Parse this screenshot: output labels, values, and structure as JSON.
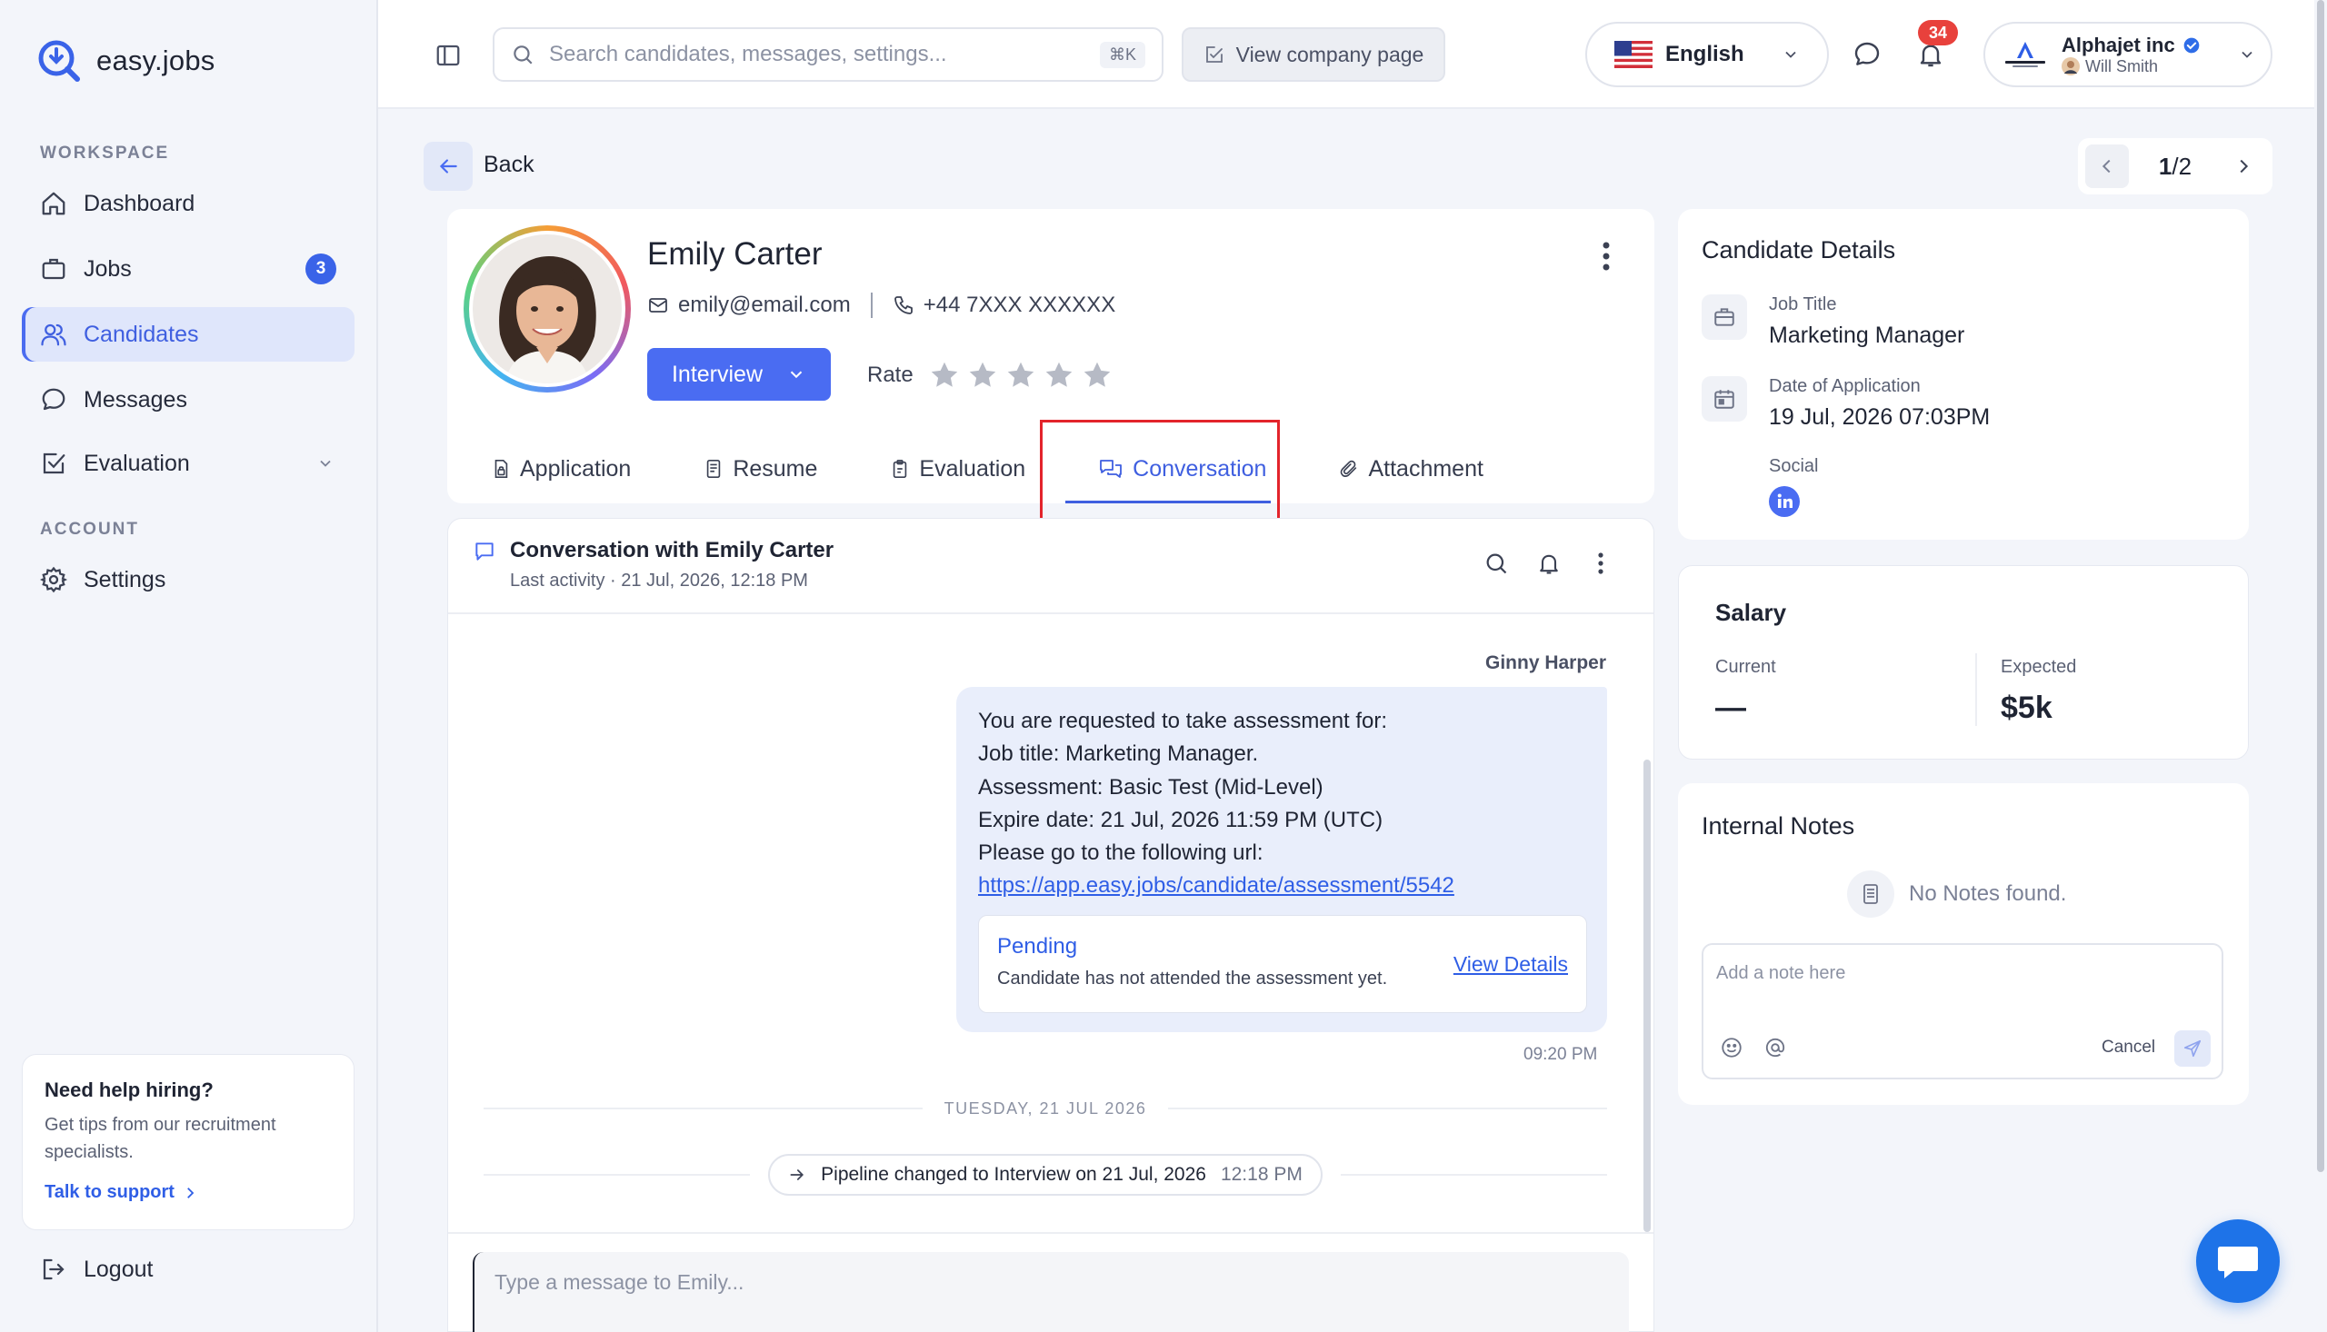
{
  "brand": {
    "name": "easy.jobs"
  },
  "sidebar": {
    "workspace_label": "WORKSPACE",
    "account_label": "ACCOUNT",
    "items": [
      {
        "label": "Dashboard"
      },
      {
        "label": "Jobs",
        "badge": "3"
      },
      {
        "label": "Candidates"
      },
      {
        "label": "Messages"
      },
      {
        "label": "Evaluation"
      },
      {
        "label": "Settings"
      }
    ],
    "help": {
      "title": "Need help hiring?",
      "text": "Get tips from our recruitment specialists.",
      "link": "Talk to support"
    },
    "logout": "Logout"
  },
  "topbar": {
    "search_placeholder": "Search candidates, messages, settings...",
    "search_shortcut": "⌘K",
    "company_button": "View company page",
    "language": "English",
    "notification_count": "34",
    "account_company": "Alphajet inc",
    "account_user": "Will Smith"
  },
  "nav": {
    "back": "Back",
    "pager_current": "1",
    "pager_total": "/2"
  },
  "candidate": {
    "name": "Emily Carter",
    "email": "emily@email.com",
    "phone": "+44 7XXX XXXXXX",
    "stage": "Interview",
    "rate_label": "Rate",
    "rating": 0
  },
  "tabs": [
    {
      "label": "Application"
    },
    {
      "label": "Resume"
    },
    {
      "label": "Evaluation"
    },
    {
      "label": "Conversation",
      "active": true
    },
    {
      "label": "Attachment"
    }
  ],
  "conversation": {
    "title": "Conversation with Emily Carter",
    "subtitle": "Last activity · 21 Jul, 2026, 12:18 PM",
    "sender": "Ginny Harper",
    "message_lines": [
      "You are requested to take assessment for:",
      "Job title: Marketing Manager.",
      "Assessment: Basic Test (Mid-Level)",
      "Expire date: 21 Jul, 2026 11:59 PM (UTC)",
      "Please go to the following url:"
    ],
    "message_link": "https://app.easy.jobs/candidate/assessment/5542",
    "assessment_status": "Pending",
    "assessment_desc": "Candidate has not attended the assessment yet.",
    "assessment_link": "View Details",
    "message_time": "09:20 PM",
    "date_divider": "TUESDAY, 21 JUL 2026",
    "pipeline_event": "Pipeline changed to Interview on 21 Jul, 2026",
    "pipeline_time": "12:18 PM",
    "composer_placeholder": "Type a message to Emily..."
  },
  "details": {
    "title": "Candidate Details",
    "job_title_label": "Job Title",
    "job_title": "Marketing Manager",
    "date_label": "Date of Application",
    "date": "19 Jul, 2026 07:03PM",
    "social_label": "Social"
  },
  "salary": {
    "title": "Salary",
    "current_label": "Current",
    "current_value": "—",
    "expected_label": "Expected",
    "expected_value": "$5k"
  },
  "notes": {
    "title": "Internal Notes",
    "empty": "No Notes found.",
    "placeholder": "Add a note here",
    "cancel": "Cancel"
  },
  "colors": {
    "accent": "#4a6cf2",
    "highlight": "#e3242b",
    "badge": "#e8413c"
  }
}
